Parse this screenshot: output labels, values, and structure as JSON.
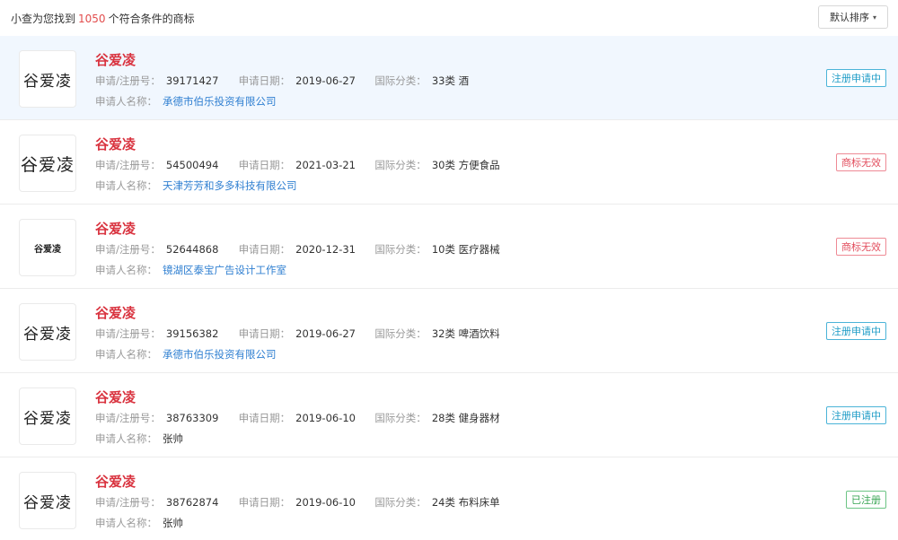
{
  "header": {
    "summary_prefix": "小查为您找到",
    "count": "1050",
    "summary_suffix": "个符合条件的商标",
    "sort_label": "默认排序",
    "sort_caret": "▾"
  },
  "labels": {
    "reg_no": "申请/注册号：",
    "apply_date": "申请日期：",
    "intl_class": "国际分类：",
    "applicant": "申请人名称："
  },
  "items": [
    {
      "logo_text": "谷爱凌",
      "title": "谷爱凌",
      "reg_no": "39171427",
      "apply_date": "2019-06-27",
      "intl_class": "33类 酒",
      "applicant": "承德市伯乐投资有限公司",
      "status": "注册申请中"
    },
    {
      "logo_text": "谷爱凌",
      "title": "谷爱凌",
      "reg_no": "54500494",
      "apply_date": "2021-03-21",
      "intl_class": "30类 方便食品",
      "applicant": "天津芳芳和多多科技有限公司",
      "status": "商标无效"
    },
    {
      "logo_text": "谷爱凌",
      "title": "谷爱凌",
      "reg_no": "52644868",
      "apply_date": "2020-12-31",
      "intl_class": "10类 医疗器械",
      "applicant": "镜湖区泰宝广告设计工作室",
      "status": "商标无效"
    },
    {
      "logo_text": "谷爱凌",
      "title": "谷爱凌",
      "reg_no": "39156382",
      "apply_date": "2019-06-27",
      "intl_class": "32类 啤酒饮料",
      "applicant": "承德市伯乐投资有限公司",
      "status": "注册申请中"
    },
    {
      "logo_text": "谷爱凌",
      "title": "谷爱凌",
      "reg_no": "38763309",
      "apply_date": "2019-06-10",
      "intl_class": "28类 健身器材",
      "applicant": "张帅",
      "status": "注册申请中"
    },
    {
      "logo_text": "谷爱凌",
      "title": "谷爱凌",
      "reg_no": "38762874",
      "apply_date": "2019-06-10",
      "intl_class": "24类 布料床单",
      "applicant": "张帅",
      "status": "已注册"
    }
  ],
  "colors": {
    "count": "#e24d4d",
    "title": "#d9333f",
    "link": "#2f7fd1",
    "status_pending": "#1e9cc7",
    "status_invalid": "#e24d5d",
    "status_registered": "#3aa655",
    "highlight_row": "#f1f7fe"
  }
}
